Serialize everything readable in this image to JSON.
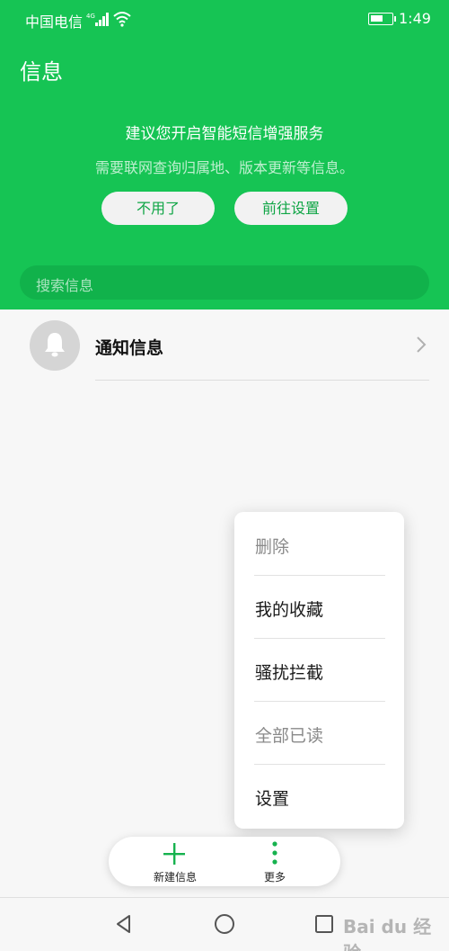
{
  "status_bar": {
    "carrier": "中国电信",
    "time": "1:49"
  },
  "header": {
    "title": "信息"
  },
  "banner": {
    "title": "建议您开启智能短信增强服务",
    "subtitle": "需要联网查询归属地、版本更新等信息。",
    "decline_label": "不用了",
    "settings_label": "前往设置"
  },
  "search": {
    "placeholder": "搜索信息"
  },
  "conversations": [
    {
      "title": "通知信息",
      "icon": "bell-icon"
    }
  ],
  "menu": {
    "items": [
      {
        "label": "删除",
        "enabled": false
      },
      {
        "label": "我的收藏",
        "enabled": true
      },
      {
        "label": "骚扰拦截",
        "enabled": true
      },
      {
        "label": "全部已读",
        "enabled": false
      },
      {
        "label": "设置",
        "enabled": true
      }
    ]
  },
  "bottom_bar": {
    "new_label": "新建信息",
    "more_label": "更多"
  },
  "watermark": "Bai du 经验",
  "colors": {
    "brand": "#16c454",
    "accent_text": "#0fa545"
  }
}
